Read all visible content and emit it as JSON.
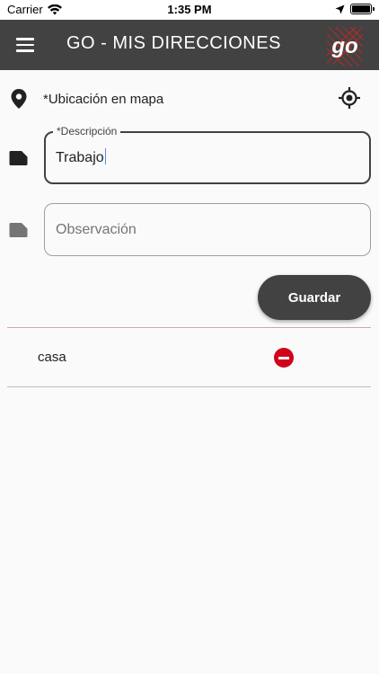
{
  "status_bar": {
    "carrier": "Carrier",
    "time": "1:35 PM"
  },
  "app_bar": {
    "title": "GO - MIS DIRECCIONES",
    "logo_text": "go",
    "background": "#424242",
    "accent": "#c62828"
  },
  "map": {
    "label": "*Ubicación en mapa",
    "location_icon": "location-pin-icon",
    "gps_icon": "gps-fixed-icon"
  },
  "form": {
    "description": {
      "label": "*Descripción",
      "value": "Trabajo",
      "icon": "label-tag-icon"
    },
    "observation": {
      "placeholder": "Observación",
      "value": "",
      "icon": "label-tag-icon"
    },
    "save_label": "Guardar"
  },
  "addresses": [
    {
      "name": "casa",
      "remove_icon": "remove-circle-icon",
      "remove_color": "#d0021b"
    }
  ]
}
